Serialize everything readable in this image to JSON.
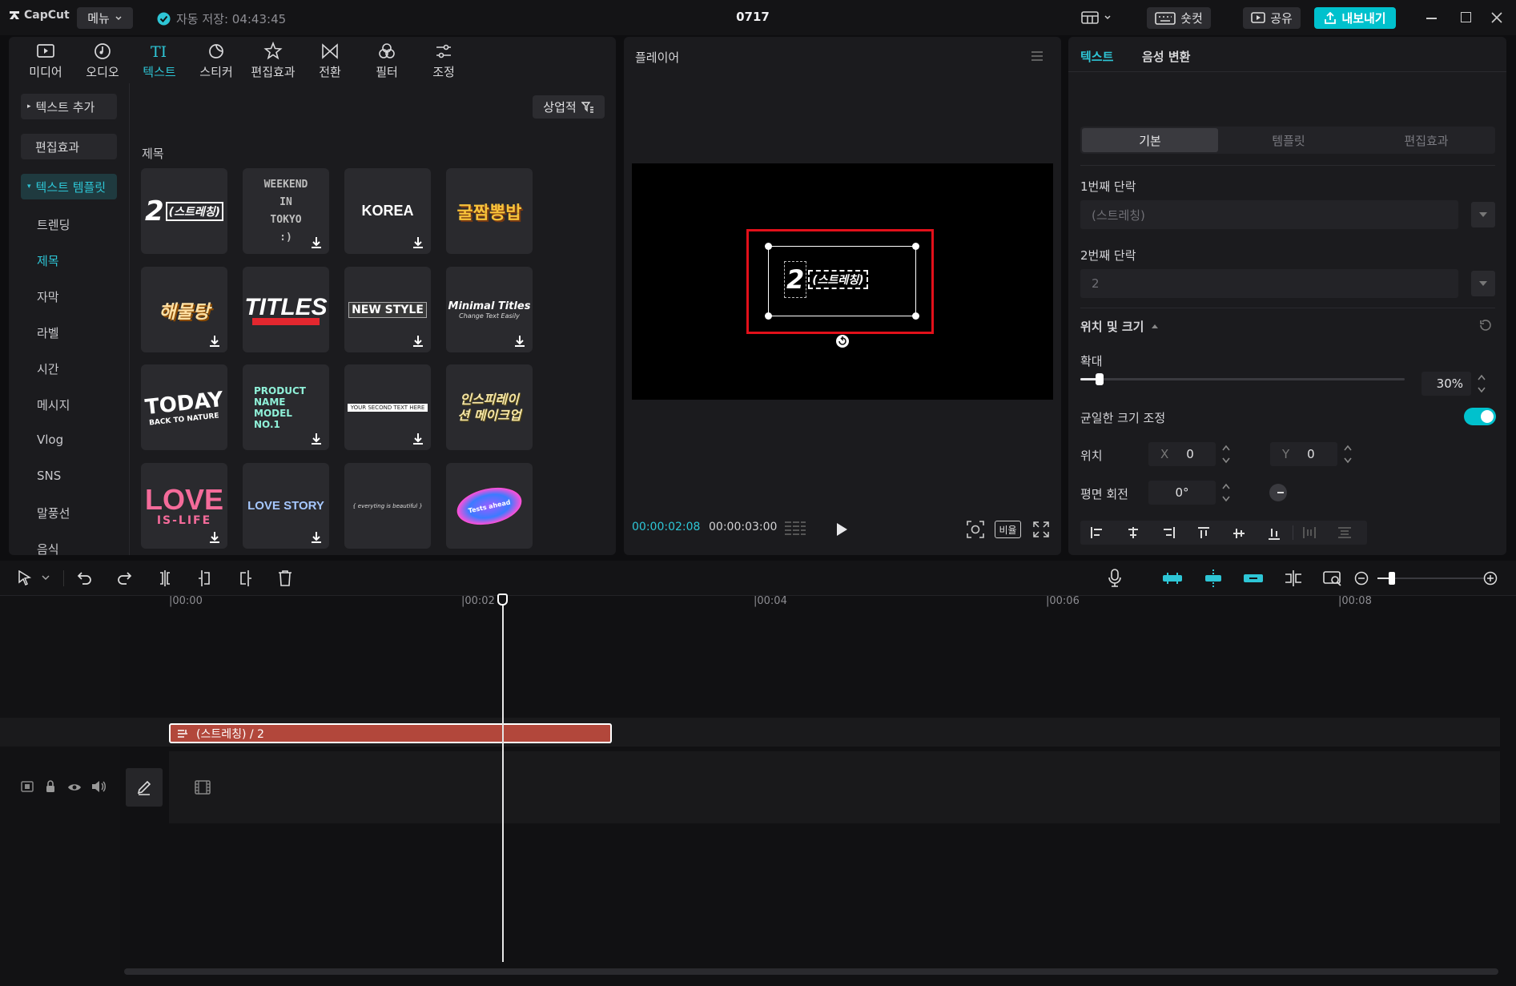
{
  "titlebar": {
    "logo": "CapCut",
    "menu_label": "메뉴",
    "autosave": "자동 저장: 04:43:45",
    "project_title": "0717",
    "shortcut_label": "숏컷",
    "share_label": "공유",
    "export_label": "내보내기",
    "accent_color": "#00c1cd"
  },
  "toolbar": {
    "items": [
      {
        "label": "미디어",
        "icon": "media-icon"
      },
      {
        "label": "오디오",
        "icon": "audio-icon"
      },
      {
        "label": "텍스트",
        "icon": "text-icon",
        "active": true
      },
      {
        "label": "스티커",
        "icon": "sticker-icon"
      },
      {
        "label": "편집효과",
        "icon": "effects-icon"
      },
      {
        "label": "전환",
        "icon": "transition-icon"
      },
      {
        "label": "필터",
        "icon": "filter-icon"
      },
      {
        "label": "조정",
        "icon": "adjust-icon"
      }
    ]
  },
  "sidebar": {
    "add_text": "텍스트 추가",
    "effects": "편집효과",
    "templates": "텍스트 템플릿",
    "items": [
      "트렌딩",
      "제목",
      "자막",
      "라벨",
      "시간",
      "메시지",
      "Vlog",
      "SNS",
      "말풍선",
      "음식"
    ],
    "active_index": 1
  },
  "library": {
    "filter_label": "상업적",
    "section_title": "제목",
    "thumbs": [
      {
        "text": "2(스트레칭)",
        "download": false
      },
      {
        "text": "WEEKEND IN TOKYO :)",
        "download": true
      },
      {
        "text": "KOREA",
        "download": true
      },
      {
        "text": "굴짬뽕밥",
        "download": false
      },
      {
        "text": "해물탕",
        "download": true
      },
      {
        "text": "TITLES",
        "download": false
      },
      {
        "text": "NEW STYLE",
        "download": true
      },
      {
        "text": "Minimal Titles",
        "sub": "Change Text Easily",
        "download": true
      },
      {
        "text": "TODAY",
        "sub": "BACK TO NATURE",
        "download": false
      },
      {
        "text": "PRODUCT NAME MODEL NO.1",
        "download": true
      },
      {
        "text": "YOUR SECOND TEXT HERE",
        "download": true
      },
      {
        "text": "인스피레이션 메이크업",
        "download": false
      },
      {
        "text": "LOVE",
        "sub": "IS-LIFE",
        "download": true
      },
      {
        "text": "LOVE STORY",
        "download": true
      },
      {
        "text": "{ everyting is beautiful }",
        "download": false
      },
      {
        "text": "Tests ahead",
        "download": false
      }
    ]
  },
  "player": {
    "title": "플레이어",
    "current_time": "00:00:02:08",
    "total_time": "00:00:03:00",
    "ratio_label": "비율",
    "preview_text_num": "2",
    "preview_text": "(스트레칭)",
    "progress": 0.69
  },
  "inspector": {
    "tabs": [
      "텍스트",
      "음성 변환"
    ],
    "segments": [
      "기본",
      "템플릿",
      "편집효과"
    ],
    "para1_label": "1번째 단락",
    "para1_value": "(스트레칭)",
    "para2_label": "2번째 단락",
    "para2_value": "2",
    "pos_size_label": "위치 및 크기",
    "scale_label": "확대",
    "scale_value": "30%",
    "scale_fraction": 0.06,
    "uniform_label": "균일한 크기 조정",
    "uniform_on": true,
    "position_label": "위치",
    "x_label": "X",
    "x_value": "0",
    "y_label": "Y",
    "y_value": "0",
    "rotation_label": "평면 회전",
    "rotation_value": "0°"
  },
  "timeline": {
    "ticks": [
      "|00:00",
      "|00:02",
      "|00:04",
      "|00:06",
      "|00:08"
    ],
    "text_clip_label": "(스트레칭) / 2",
    "clip_color": "#b2473b"
  }
}
